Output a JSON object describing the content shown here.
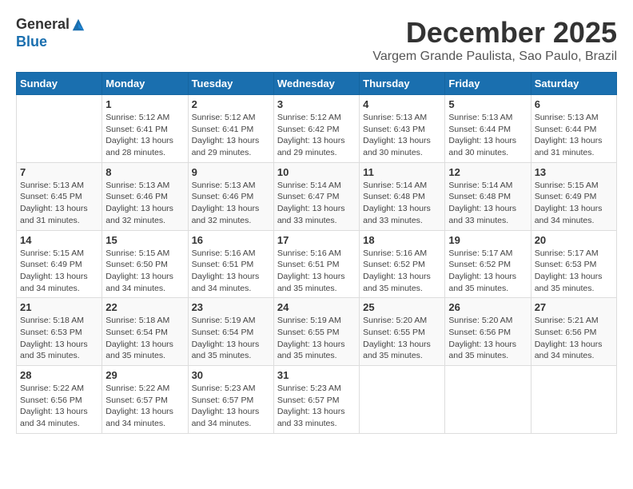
{
  "header": {
    "logo_line1": "General",
    "logo_line2": "Blue",
    "month_title": "December 2025",
    "location": "Vargem Grande Paulista, Sao Paulo, Brazil"
  },
  "calendar": {
    "days_of_week": [
      "Sunday",
      "Monday",
      "Tuesday",
      "Wednesday",
      "Thursday",
      "Friday",
      "Saturday"
    ],
    "weeks": [
      [
        {
          "day": "",
          "info": ""
        },
        {
          "day": "1",
          "info": "Sunrise: 5:12 AM\nSunset: 6:41 PM\nDaylight: 13 hours\nand 28 minutes."
        },
        {
          "day": "2",
          "info": "Sunrise: 5:12 AM\nSunset: 6:41 PM\nDaylight: 13 hours\nand 29 minutes."
        },
        {
          "day": "3",
          "info": "Sunrise: 5:12 AM\nSunset: 6:42 PM\nDaylight: 13 hours\nand 29 minutes."
        },
        {
          "day": "4",
          "info": "Sunrise: 5:13 AM\nSunset: 6:43 PM\nDaylight: 13 hours\nand 30 minutes."
        },
        {
          "day": "5",
          "info": "Sunrise: 5:13 AM\nSunset: 6:44 PM\nDaylight: 13 hours\nand 30 minutes."
        },
        {
          "day": "6",
          "info": "Sunrise: 5:13 AM\nSunset: 6:44 PM\nDaylight: 13 hours\nand 31 minutes."
        }
      ],
      [
        {
          "day": "7",
          "info": "Sunrise: 5:13 AM\nSunset: 6:45 PM\nDaylight: 13 hours\nand 31 minutes."
        },
        {
          "day": "8",
          "info": "Sunrise: 5:13 AM\nSunset: 6:46 PM\nDaylight: 13 hours\nand 32 minutes."
        },
        {
          "day": "9",
          "info": "Sunrise: 5:13 AM\nSunset: 6:46 PM\nDaylight: 13 hours\nand 32 minutes."
        },
        {
          "day": "10",
          "info": "Sunrise: 5:14 AM\nSunset: 6:47 PM\nDaylight: 13 hours\nand 33 minutes."
        },
        {
          "day": "11",
          "info": "Sunrise: 5:14 AM\nSunset: 6:48 PM\nDaylight: 13 hours\nand 33 minutes."
        },
        {
          "day": "12",
          "info": "Sunrise: 5:14 AM\nSunset: 6:48 PM\nDaylight: 13 hours\nand 33 minutes."
        },
        {
          "day": "13",
          "info": "Sunrise: 5:15 AM\nSunset: 6:49 PM\nDaylight: 13 hours\nand 34 minutes."
        }
      ],
      [
        {
          "day": "14",
          "info": "Sunrise: 5:15 AM\nSunset: 6:49 PM\nDaylight: 13 hours\nand 34 minutes."
        },
        {
          "day": "15",
          "info": "Sunrise: 5:15 AM\nSunset: 6:50 PM\nDaylight: 13 hours\nand 34 minutes."
        },
        {
          "day": "16",
          "info": "Sunrise: 5:16 AM\nSunset: 6:51 PM\nDaylight: 13 hours\nand 34 minutes."
        },
        {
          "day": "17",
          "info": "Sunrise: 5:16 AM\nSunset: 6:51 PM\nDaylight: 13 hours\nand 35 minutes."
        },
        {
          "day": "18",
          "info": "Sunrise: 5:16 AM\nSunset: 6:52 PM\nDaylight: 13 hours\nand 35 minutes."
        },
        {
          "day": "19",
          "info": "Sunrise: 5:17 AM\nSunset: 6:52 PM\nDaylight: 13 hours\nand 35 minutes."
        },
        {
          "day": "20",
          "info": "Sunrise: 5:17 AM\nSunset: 6:53 PM\nDaylight: 13 hours\nand 35 minutes."
        }
      ],
      [
        {
          "day": "21",
          "info": "Sunrise: 5:18 AM\nSunset: 6:53 PM\nDaylight: 13 hours\nand 35 minutes."
        },
        {
          "day": "22",
          "info": "Sunrise: 5:18 AM\nSunset: 6:54 PM\nDaylight: 13 hours\nand 35 minutes."
        },
        {
          "day": "23",
          "info": "Sunrise: 5:19 AM\nSunset: 6:54 PM\nDaylight: 13 hours\nand 35 minutes."
        },
        {
          "day": "24",
          "info": "Sunrise: 5:19 AM\nSunset: 6:55 PM\nDaylight: 13 hours\nand 35 minutes."
        },
        {
          "day": "25",
          "info": "Sunrise: 5:20 AM\nSunset: 6:55 PM\nDaylight: 13 hours\nand 35 minutes."
        },
        {
          "day": "26",
          "info": "Sunrise: 5:20 AM\nSunset: 6:56 PM\nDaylight: 13 hours\nand 35 minutes."
        },
        {
          "day": "27",
          "info": "Sunrise: 5:21 AM\nSunset: 6:56 PM\nDaylight: 13 hours\nand 34 minutes."
        }
      ],
      [
        {
          "day": "28",
          "info": "Sunrise: 5:22 AM\nSunset: 6:56 PM\nDaylight: 13 hours\nand 34 minutes."
        },
        {
          "day": "29",
          "info": "Sunrise: 5:22 AM\nSunset: 6:57 PM\nDaylight: 13 hours\nand 34 minutes."
        },
        {
          "day": "30",
          "info": "Sunrise: 5:23 AM\nSunset: 6:57 PM\nDaylight: 13 hours\nand 34 minutes."
        },
        {
          "day": "31",
          "info": "Sunrise: 5:23 AM\nSunset: 6:57 PM\nDaylight: 13 hours\nand 33 minutes."
        },
        {
          "day": "",
          "info": ""
        },
        {
          "day": "",
          "info": ""
        },
        {
          "day": "",
          "info": ""
        }
      ]
    ]
  }
}
